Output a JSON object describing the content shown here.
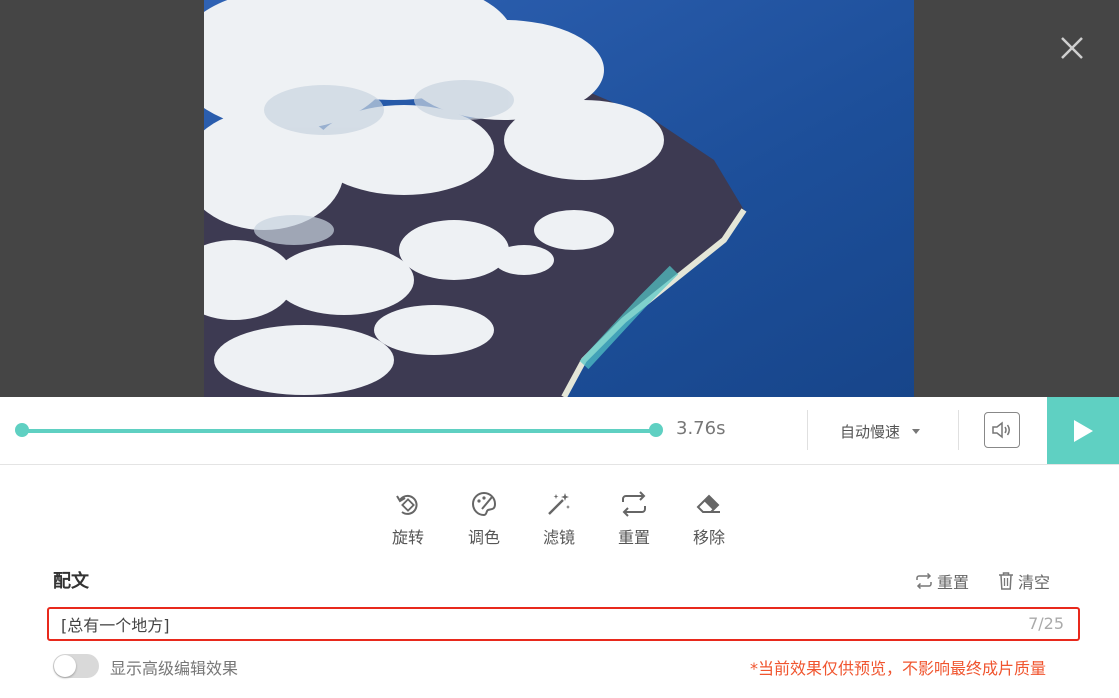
{
  "preview": {
    "image_description_icon": "aerial-coast-clouds-image"
  },
  "close": {
    "icon": "close-icon"
  },
  "player": {
    "progress": 1.0,
    "time": "3.76s",
    "speed_label": "自动慢速",
    "accent_color": "#5fd0c2"
  },
  "tools": [
    {
      "key": "rotate",
      "label": "旋转",
      "icon": "rotate-icon"
    },
    {
      "key": "color",
      "label": "调色",
      "icon": "palette-icon"
    },
    {
      "key": "filter",
      "label": "滤镜",
      "icon": "magic-wand-icon"
    },
    {
      "key": "reset",
      "label": "重置",
      "icon": "repeat-icon"
    },
    {
      "key": "remove",
      "label": "移除",
      "icon": "eraser-icon"
    }
  ],
  "caption": {
    "title": "配文",
    "reset_label": "重置",
    "clear_label": "清空",
    "value": "[总有一个地方]",
    "counter": "7/25",
    "highlight_color": "#e8291c"
  },
  "advanced": {
    "toggle_label": "显示高级编辑效果",
    "enabled": false
  },
  "notice": "*当前效果仅供预览，不影响最终成片质量"
}
